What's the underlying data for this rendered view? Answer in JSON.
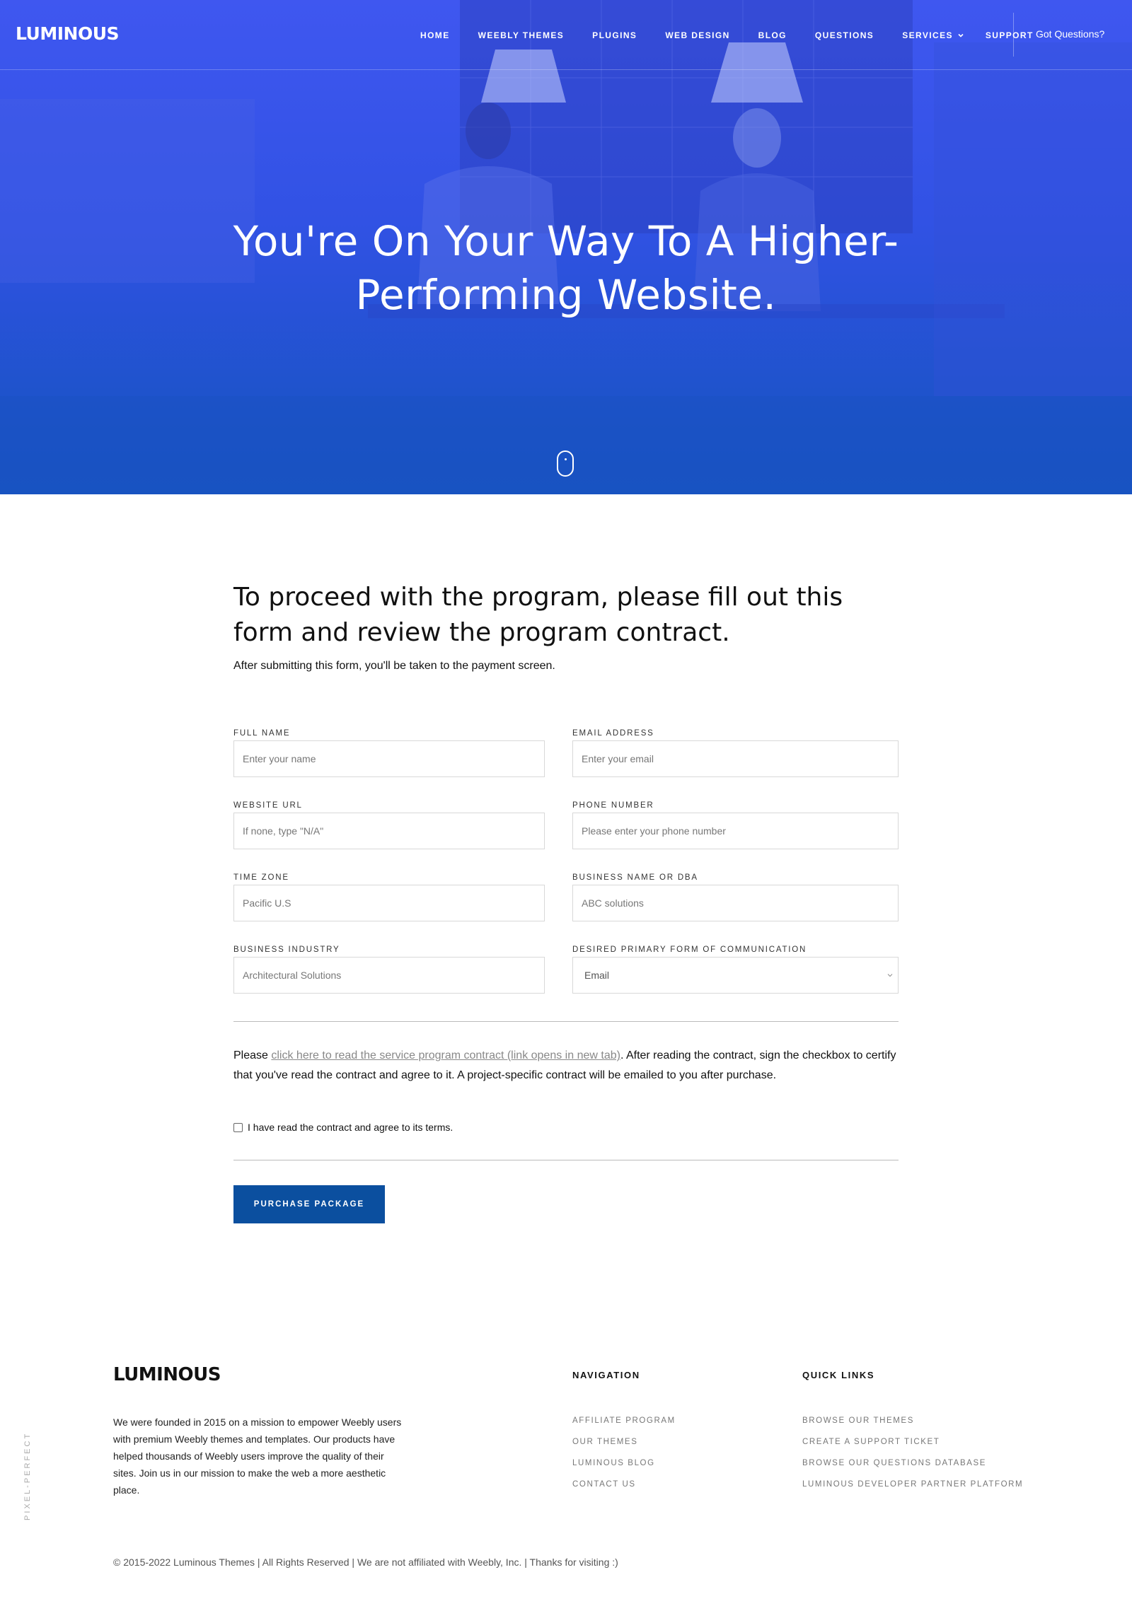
{
  "brand": {
    "logo_text": "LUMINOUS"
  },
  "nav": {
    "items": [
      {
        "label": "HOME"
      },
      {
        "label": "WEEBLY THEMES"
      },
      {
        "label": "PLUGINS"
      },
      {
        "label": "WEB DESIGN"
      },
      {
        "label": "BLOG"
      },
      {
        "label": "QUESTIONS"
      },
      {
        "label": "SERVICES",
        "icon": "chevron-down-icon"
      },
      {
        "label": "SUPPORT"
      }
    ],
    "cta": "Got Questions?"
  },
  "hero": {
    "title_line1": "You're On Your Way To A Higher-",
    "title_line2": "Performing Website.",
    "scroll_icon": "mouse-scroll-icon"
  },
  "form": {
    "title": "To proceed with the program, please fill out this form and review the program contract.",
    "subtitle": "After submitting this form, you'll be taken to the payment screen.",
    "fields": {
      "full_name": {
        "label": "FULL NAME",
        "placeholder": "Enter your name"
      },
      "email": {
        "label": "EMAIL ADDRESS",
        "placeholder": "Enter your email"
      },
      "website": {
        "label": "WEBSITE URL",
        "placeholder": "If none, type \"N/A\""
      },
      "phone": {
        "label": "PHONE NUMBER",
        "placeholder": "Please enter your phone number"
      },
      "timezone": {
        "label": "TIME ZONE",
        "placeholder": "Pacific U.S"
      },
      "business_name": {
        "label": "BUSINESS NAME OR DBA",
        "placeholder": "ABC solutions"
      },
      "industry": {
        "label": "BUSINESS INDUSTRY",
        "placeholder": "Architectural Solutions"
      },
      "communication": {
        "label": "DESIRED PRIMARY FORM OF COMMUNICATION",
        "value": "Email"
      }
    },
    "contract": {
      "before": "Please ",
      "link": "click here to read the service program contract (link opens in new tab)",
      "after": ". After reading the contract, sign the checkbox to certify that you've read the contract and agree to it. A project-specific contract will be emailed to you after purchase."
    },
    "agree_label": "I have read the contract and agree to its terms.",
    "submit_label": "PURCHASE PACKAGE"
  },
  "footer": {
    "logo_text": "LUMINOUS",
    "about": "We were founded in 2015 on a mission to empower Weebly users with premium Weebly themes and templates. Our products have helped thousands of Weebly users improve the quality of their sites. Join us in our mission to make the web a more aesthetic place.",
    "navigation": {
      "heading": "NAVIGATION",
      "links": [
        "AFFILIATE PROGRAM",
        "OUR THEMES",
        "LUMINOUS BLOG",
        "CONTACT US"
      ]
    },
    "quick_links": {
      "heading": "QUICK LINKS",
      "links": [
        "BROWSE OUR THEMES",
        "CREATE A SUPPORT TICKET",
        "BROWSE OUR QUESTIONS DATABASE",
        "LUMINOUS DEVELOPER PARTNER PLATFORM"
      ]
    },
    "side_label": "PIXEL-PERFECT",
    "copyright": "© 2015-2022 Luminous Themes | All Rights Reserved | We are not affiliated with Weebly, Inc. | Thanks for visiting :)"
  },
  "colors": {
    "hero_blue": "#3b55ee",
    "button_blue": "#0b4f9f",
    "link_gray": "#888888"
  }
}
